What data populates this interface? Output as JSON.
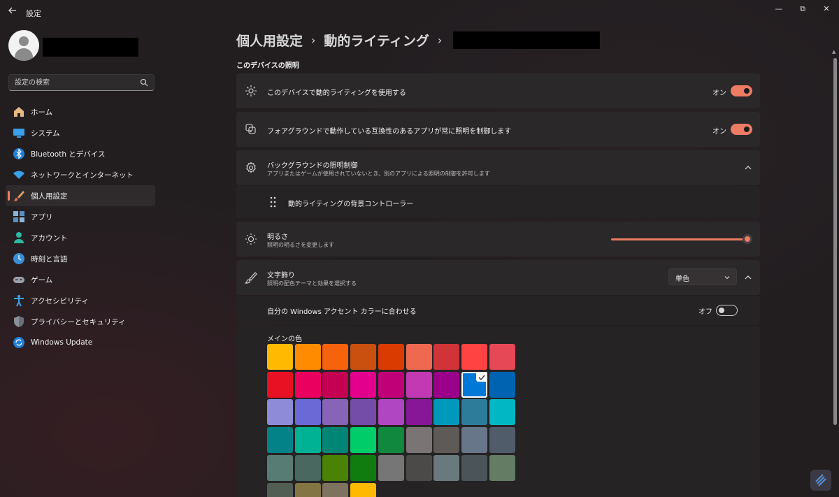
{
  "window": {
    "title": "設定",
    "minimize_glyph": "—",
    "maximize_glyph": "⧉",
    "close_glyph": "✕"
  },
  "sidebar": {
    "search_placeholder": "設定の検索",
    "items": [
      {
        "label": "ホーム",
        "icon": "home-icon"
      },
      {
        "label": "システム",
        "icon": "system-icon"
      },
      {
        "label": "Bluetooth とデバイス",
        "icon": "bluetooth-icon"
      },
      {
        "label": "ネットワークとインターネット",
        "icon": "network-icon"
      },
      {
        "label": "個人用設定",
        "icon": "brush-icon",
        "active": true
      },
      {
        "label": "アプリ",
        "icon": "apps-icon"
      },
      {
        "label": "アカウント",
        "icon": "account-icon"
      },
      {
        "label": "時刻と言語",
        "icon": "time-language-icon"
      },
      {
        "label": "ゲーム",
        "icon": "gamepad-icon"
      },
      {
        "label": "アクセシビリティ",
        "icon": "accessibility-icon"
      },
      {
        "label": "プライバシーとセキュリティ",
        "icon": "shield-icon"
      },
      {
        "label": "Windows Update",
        "icon": "update-icon"
      }
    ]
  },
  "breadcrumb": {
    "item1": "個人用設定",
    "item2": "動的ライティング",
    "separator": "›"
  },
  "main": {
    "section_title": "このデバイスの照明",
    "use_dynamic": {
      "title": "このデバイスで動的ライティングを使用する",
      "state_label": "オン",
      "on": true
    },
    "foreground": {
      "title": "フォアグラウンドで動作している互換性のあるアプリが常に照明を制御します",
      "state_label": "オン",
      "on": true
    },
    "background": {
      "title": "バックグラウンドの照明制御",
      "desc": "アプリまたはゲームが使用されていないとき、別のアプリによる照明の制御を許可します",
      "controller_label": "動的ライティングの背景コントローラー"
    },
    "brightness": {
      "title": "明るさ",
      "desc": "照明の明るさを変更します",
      "value_fraction": 1.0
    },
    "effects": {
      "title": "文字飾り",
      "desc": "照明の配色テーマと効果を選択する",
      "dropdown_value": "単色"
    },
    "accent_match": {
      "title": "自分の Windows アクセント カラーに合わせる",
      "state_label": "オフ",
      "on": false
    },
    "main_color": {
      "label": "メインの色",
      "selected_index": 16,
      "colors": [
        "#ffb900",
        "#ff8c00",
        "#f7630c",
        "#ca5010",
        "#da3b01",
        "#ef6950",
        "#d13438",
        "#ff4343",
        "#e74856",
        "#e81123",
        "#ea005e",
        "#c30052",
        "#e3008c",
        "#bf0077",
        "#c239b3",
        "#9a0089",
        "#0078d7",
        "#0063b1",
        "#8e8cd8",
        "#6b69d6",
        "#8764b8",
        "#744da9",
        "#b146c2",
        "#881798",
        "#0099bc",
        "#2d7d9a",
        "#00b7c3",
        "#038387",
        "#00b294",
        "#018574",
        "#00cc6a",
        "#10893e",
        "#7a7574",
        "#5d5a58",
        "#68768a",
        "#515c6b",
        "#567c73",
        "#486860",
        "#498205",
        "#107c10",
        "#767676",
        "#4c4a48",
        "#69797e",
        "#4a5459",
        "#647c64",
        "#525e54",
        "#847545",
        "#7e735f",
        "#ffb900"
      ]
    }
  },
  "colors": {
    "accent": "#ee7b64",
    "background": "#221e20",
    "card": "#2b2829"
  }
}
